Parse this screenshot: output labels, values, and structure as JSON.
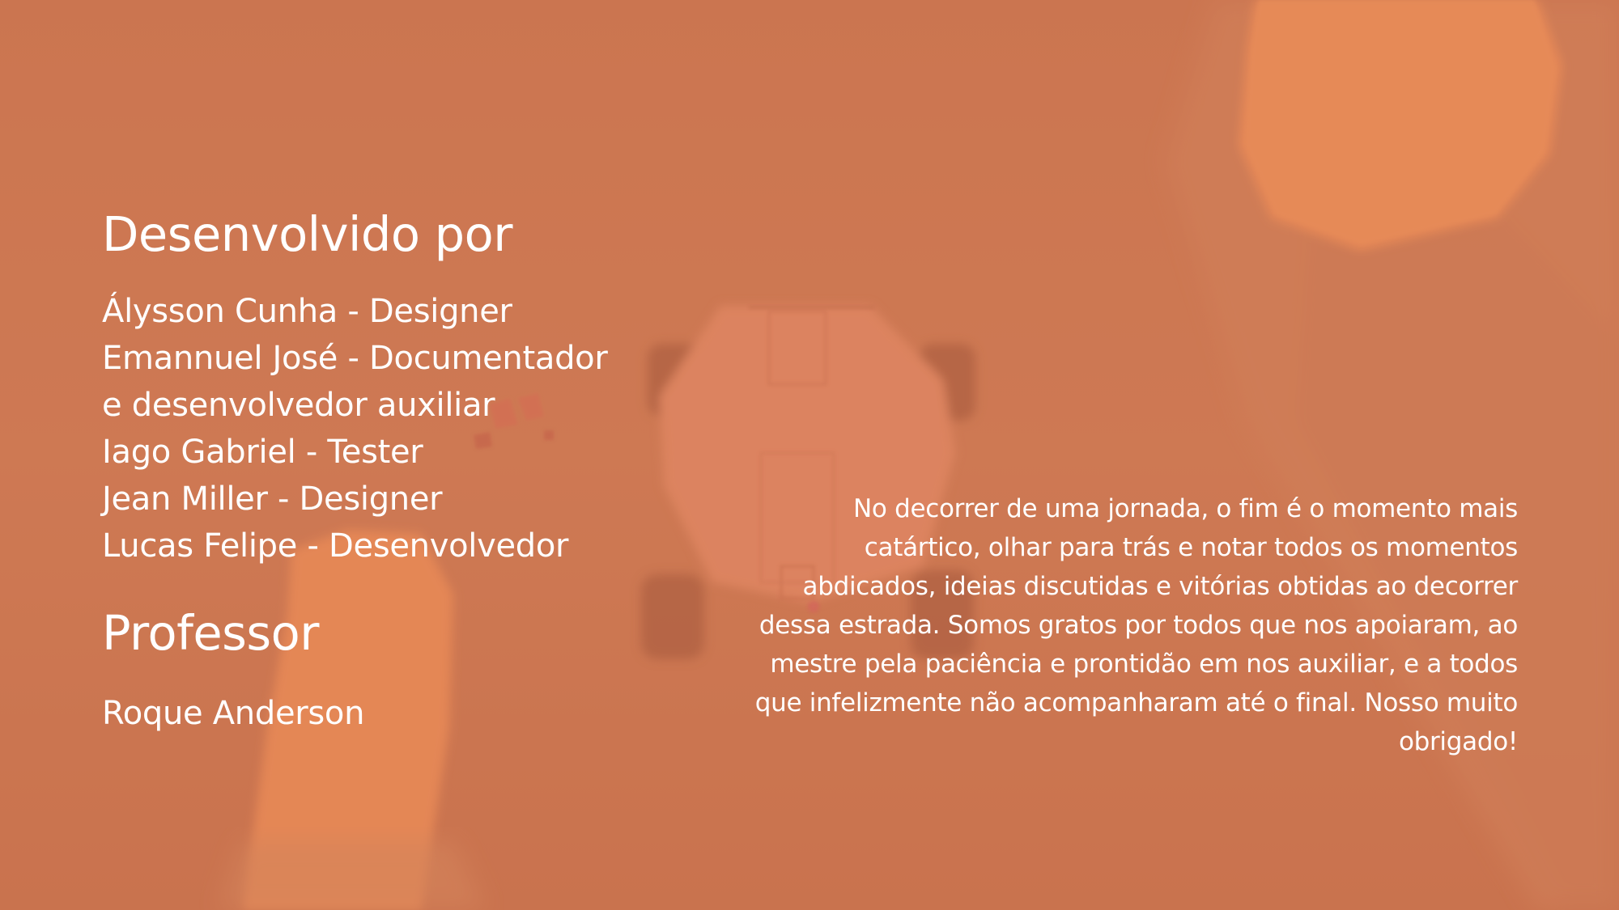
{
  "credits": {
    "developed_by_heading": "Desenvolvido por",
    "members": [
      "Álysson Cunha - Designer",
      "Emannuel José - Documentador e desenvolvedor auxiliar",
      "Iago Gabriel - Tester",
      "Jean Miller - Designer",
      "Lucas Felipe - Desenvolvedor"
    ],
    "professor_heading": "Professor",
    "professor_name": "Roque Anderson"
  },
  "thanks_message": "No decorrer de uma jornada, o fim é o momento mais catártico, olhar para trás e notar todos os momentos abdicados, ideias discutidas e vitórias obtidas ao decorrer dessa estrada. Somos gratos por todos que nos apoiaram, ao mestre pela paciência e prontidão em nos auxiliar, e a todos que infelizmente não acompanharam até o final. Nosso muito obrigado!",
  "colors": {
    "background": "#cd7651",
    "terrain_highlight": "#f4925a",
    "vehicle_body": "#e58a68",
    "wheel": "#a65a3f",
    "text": "#ffffff"
  }
}
